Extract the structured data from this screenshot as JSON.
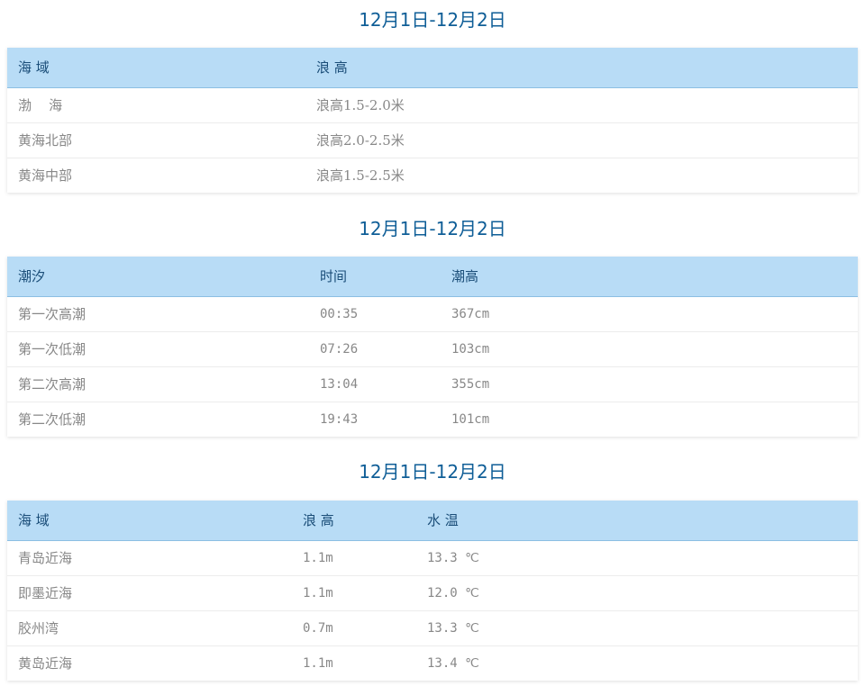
{
  "wave": {
    "title": "12月1日-12月2日",
    "headers": [
      "海 域",
      "浪 高"
    ],
    "rows": [
      [
        "渤    海",
        "浪高1.5-2.0米"
      ],
      [
        "黄海北部",
        "浪高2.0-2.5米"
      ],
      [
        "黄海中部",
        "浪高1.5-2.5米"
      ]
    ]
  },
  "tide": {
    "title": "12月1日-12月2日",
    "headers": [
      "潮汐",
      "时间",
      "潮高"
    ],
    "rows": [
      [
        "第一次高潮",
        "00:35",
        "367cm"
      ],
      [
        "第一次低潮",
        "07:26",
        "103cm"
      ],
      [
        "第二次高潮",
        "13:04",
        "355cm"
      ],
      [
        "第二次低潮",
        "19:43",
        "101cm"
      ]
    ]
  },
  "coastal": {
    "title": "12月1日-12月2日",
    "headers": [
      "海 域",
      "浪 高",
      "水 温"
    ],
    "rows": [
      [
        "青岛近海",
        "1.1m",
        "13.3 ℃"
      ],
      [
        "即墨近海",
        "1.1m",
        "12.0 ℃"
      ],
      [
        "胶州湾",
        "0.7m",
        "13.3 ℃"
      ],
      [
        "黄岛近海",
        "1.1m",
        "13.4 ℃"
      ]
    ]
  }
}
